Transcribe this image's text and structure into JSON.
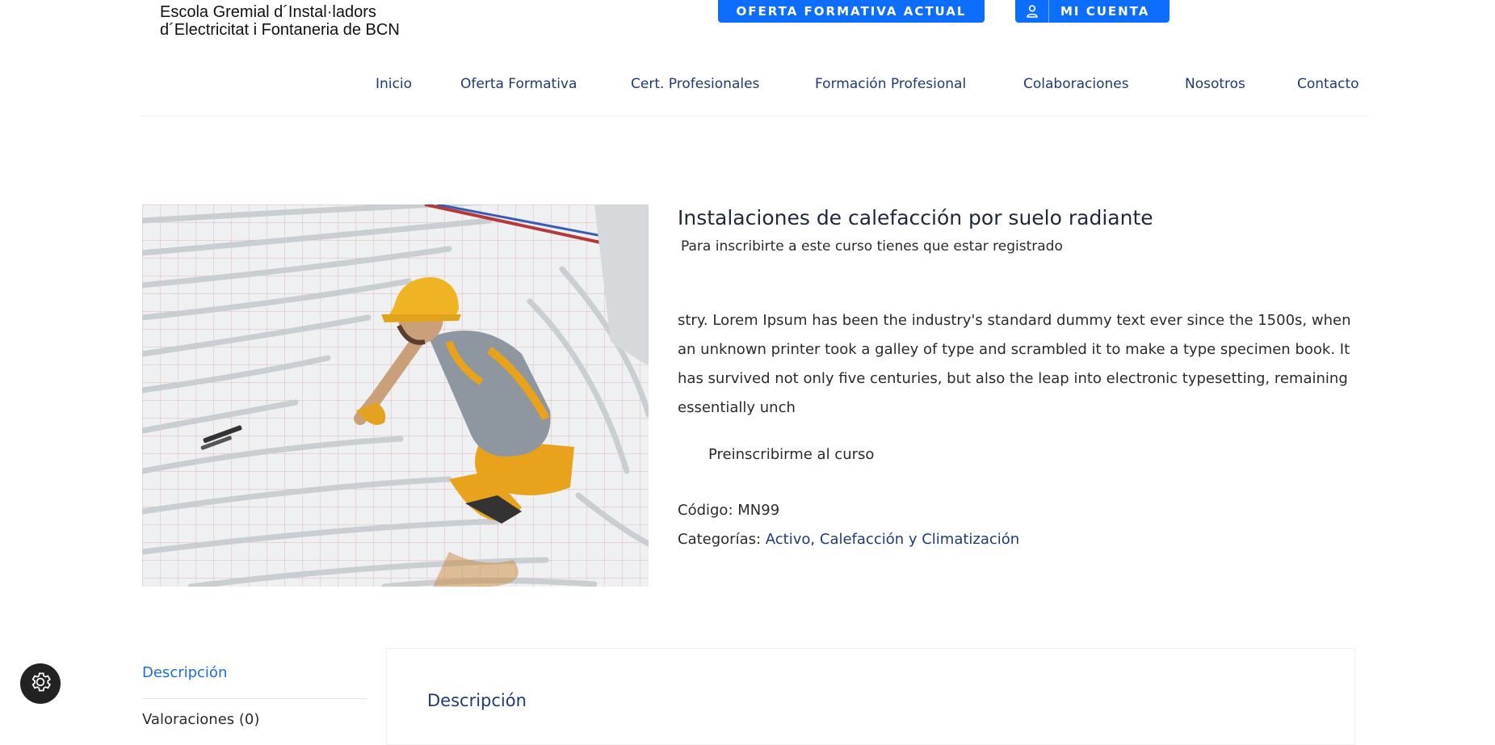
{
  "header": {
    "logo_line1": "Escola Gremial d´Instal·ladors",
    "logo_line2": "d´Electricitat i Fontaneria de BCN",
    "oferta_button": "OFERTA FORMATIVA ACTUAL",
    "cuenta_button": "MI CUENTA",
    "cuenta_icon": "user-icon"
  },
  "nav": {
    "items": [
      {
        "label": "Inicio"
      },
      {
        "label": "Oferta Formativa"
      },
      {
        "label": "Cert. Profesionales"
      },
      {
        "label": "Formación Profesional"
      },
      {
        "label": "Colaboraciones"
      },
      {
        "label": "Nosotros"
      },
      {
        "label": "Contacto"
      }
    ]
  },
  "product": {
    "image": "worker-installing-underfloor-heating",
    "title": "Instalaciones de calefacción por suelo radiante",
    "subtitle": "Para inscribirte a este curso tienes que estar registrado",
    "description": "stry. Lorem Ipsum has been the industry's standard dummy text ever since the 1500s, when an unknown printer took a galley of type and scrambled it to make a type specimen book. It has survived not only five centuries, but also the leap into electronic typesetting, remaining essentially unch",
    "preinscribe_button": "Preinscribirme al curso",
    "codigo_label": "Código:",
    "codigo_value": "MN99",
    "categorias_label": "Categorías:",
    "categoria_1": "Activo",
    "categoria_sep": ",",
    "categoria_2": "Calefacción y Climatización"
  },
  "tabs": {
    "descripcion": "Descripción",
    "valoraciones": "Valoraciones (0)",
    "panel_title": "Descripción"
  },
  "widgets": {
    "settings_icon": "gear-icon"
  },
  "colors": {
    "primary_button": "#0d6efd",
    "nav_text": "#1f3b73",
    "active_tab": "#1a6ed8",
    "helmet": "#f0b323"
  }
}
